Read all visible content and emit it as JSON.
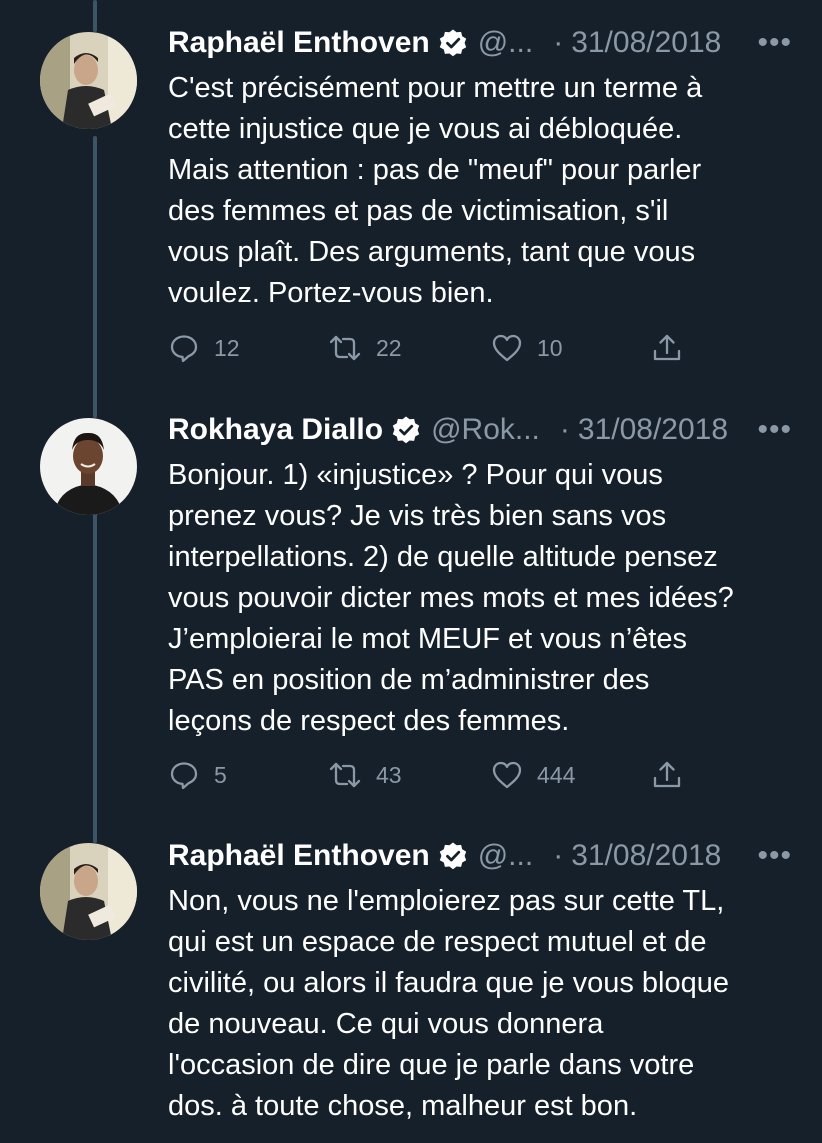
{
  "tweets": [
    {
      "author": "Raphaël Enthoven",
      "handle": "@...",
      "separator": "·",
      "date": "31/08/2018",
      "more": "•••",
      "text_lines": [
        "C'est précisément pour mettre un terme à",
        "cette injustice que je vous ai débloquée.",
        "Mais attention : pas de \"meuf\" pour parler",
        "des femmes et pas de victimisation, s'il",
        "vous plaît. Des arguments, tant que vous",
        "voulez. Portez-vous bien."
      ],
      "replies": "12",
      "retweets": "22",
      "likes": "10"
    },
    {
      "author": "Rokhaya Diallo",
      "handle": "@Rok...",
      "separator": "·",
      "date": "31/08/2018",
      "more": "•••",
      "text_lines": [
        "Bonjour. 1) «injustice» ? Pour qui vous",
        "prenez vous? Je vis très bien sans vos",
        "interpellations. 2) de quelle altitude pensez",
        "vous pouvoir dicter mes mots et mes idées?",
        "J’emploierai le mot MEUF et vous n’êtes",
        "PAS en position de m’administrer des",
        "leçons de respect des femmes."
      ],
      "replies": "5",
      "retweets": "43",
      "likes": "444"
    },
    {
      "author": "Raphaël Enthoven",
      "handle": "@...",
      "separator": "·",
      "date": "31/08/2018",
      "more": "•••",
      "text_lines": [
        "Non, vous ne l'emploierez pas sur cette TL,",
        "qui est un espace de respect mutuel et de",
        "civilité, ou alors il faudra que je vous bloque",
        "de nouveau. Ce qui vous donnera",
        "l'occasion de dire que je parle dans votre",
        "dos. à toute chose, malheur est bon."
      ]
    }
  ],
  "icons": {
    "verified": "verified-badge-icon",
    "reply": "reply-icon",
    "retweet": "retweet-icon",
    "like": "heart-icon",
    "share": "share-icon",
    "more": "more-icon"
  },
  "colors": {
    "background": "#15202b",
    "text": "#ffffff",
    "secondary_text": "#8b98a5",
    "thread_line": "#3d5466"
  }
}
